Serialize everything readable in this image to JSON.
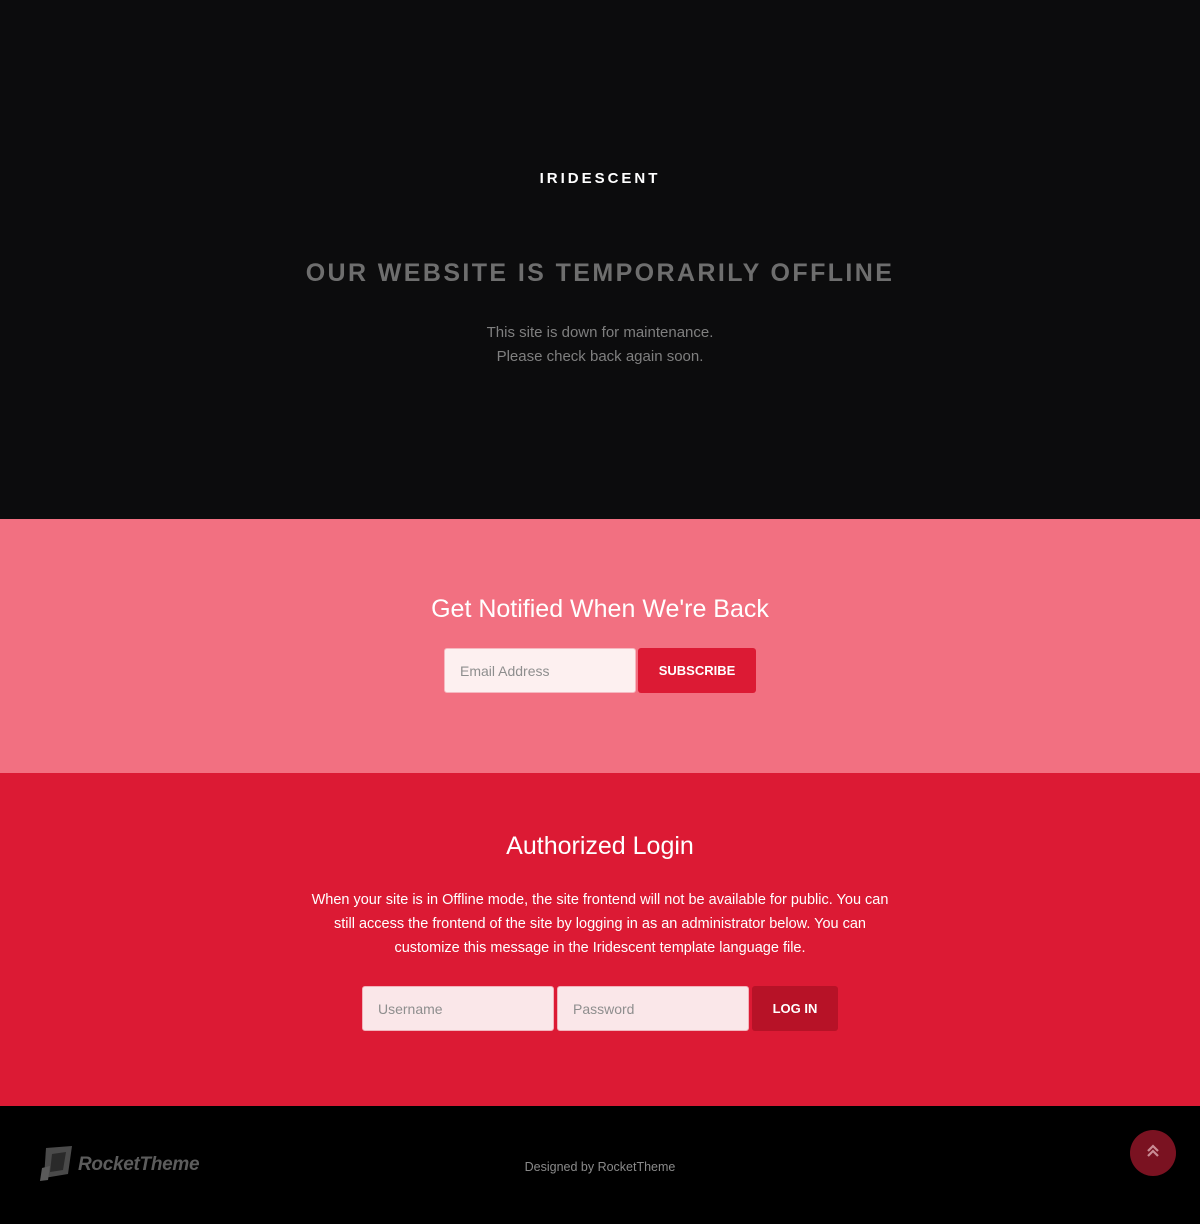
{
  "hero": {
    "brand": "IRIDESCENT",
    "headline": "OUR WEBSITE IS TEMPORARILY OFFLINE",
    "message_line1": "This site is down for maintenance.",
    "message_line2": "Please check back again soon."
  },
  "notify": {
    "title": "Get Notified When We're Back",
    "email_placeholder": "Email Address",
    "subscribe_label": "SUBSCRIBE"
  },
  "login": {
    "title": "Authorized Login",
    "description": "When your site is in Offline mode, the site frontend will not be available for public. You can still access the frontend of the site by logging in as an administrator below. You can customize this message in the Iridescent template language file.",
    "username_placeholder": "Username",
    "password_placeholder": "Password",
    "login_label": "LOG IN"
  },
  "footer": {
    "logo_text": "RocketTheme",
    "credit": "Designed by RocketTheme",
    "back_to_top_icon": "double-chevron-up-icon"
  },
  "colors": {
    "hero_bg": "#0c0c0d",
    "notify_bg": "#f27081",
    "login_bg": "#dc1a34",
    "login_button": "#b71227",
    "footer_bg": "#000000"
  }
}
